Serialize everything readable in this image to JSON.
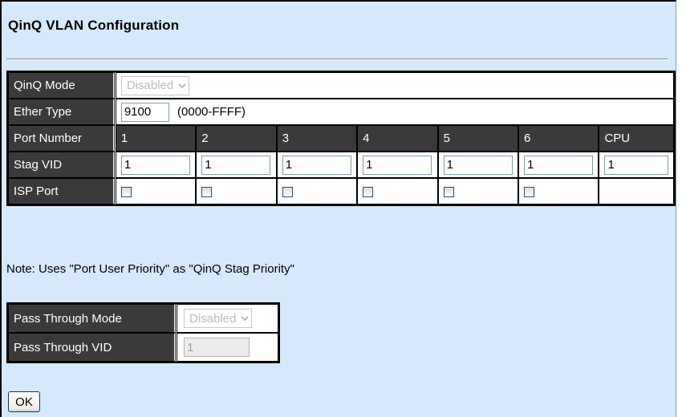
{
  "title": "QinQ VLAN Configuration",
  "qinq_mode": {
    "label": "QinQ Mode",
    "value": "Disabled"
  },
  "ether_type": {
    "label": "Ether Type",
    "value": "9100",
    "range": "(0000-FFFF)"
  },
  "port_header": {
    "label": "Port Number",
    "ports": [
      "1",
      "2",
      "3",
      "4",
      "5",
      "6",
      "CPU"
    ]
  },
  "stag_vid": {
    "label": "Stag VID",
    "values": [
      "1",
      "1",
      "1",
      "1",
      "1",
      "1",
      "1"
    ]
  },
  "isp_port": {
    "label": "ISP Port",
    "checked": [
      false,
      false,
      false,
      false,
      false,
      false
    ]
  },
  "note": "Note: Uses \"Port User Priority\" as \"QinQ Stag Priority\"",
  "pass_through": {
    "mode_label": "Pass Through Mode",
    "mode_value": "Disabled",
    "vid_label": "Pass Through VID",
    "vid_value": "1"
  },
  "ok_label": "OK"
}
